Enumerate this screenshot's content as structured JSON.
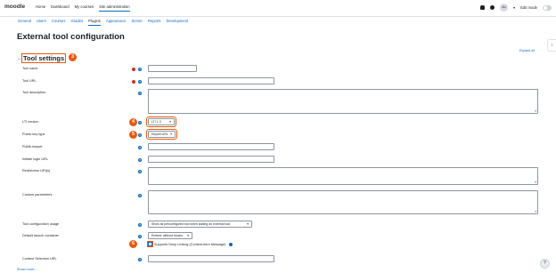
{
  "header": {
    "logo": "moodle",
    "nav": [
      "Home",
      "Dashboard",
      "My courses",
      "Site administration"
    ],
    "active_nav_index": 3,
    "avatar_initials": "AU",
    "edit_mode_label": "Edit mode"
  },
  "subnav": {
    "tabs": [
      "General",
      "Users",
      "Courses",
      "Grades",
      "Plugins",
      "Appearance",
      "Server",
      "Reports",
      "Development"
    ],
    "active_index": 4
  },
  "page": {
    "title": "External tool configuration",
    "expand_all": "Expand all"
  },
  "section": {
    "title": "Tool settings",
    "badge": "3"
  },
  "fields": {
    "tool_name": {
      "label": "Tool name",
      "value": ""
    },
    "tool_url": {
      "label": "Tool URL",
      "value": ""
    },
    "tool_description": {
      "label": "Tool description",
      "value": ""
    },
    "lti_version": {
      "label": "LTI version",
      "value": "LTI 1.3",
      "badge": "4"
    },
    "public_key_type": {
      "label": "Public key type",
      "value": "Keyset URL",
      "badge": "5"
    },
    "public_keyset": {
      "label": "Public keyset",
      "value": ""
    },
    "initiate_login_url": {
      "label": "Initiate login URL",
      "value": ""
    },
    "redirection_uris": {
      "label": "Redirection URI(s)",
      "value": ""
    },
    "custom_parameters": {
      "label": "Custom parameters",
      "value": ""
    },
    "tool_config_usage": {
      "label": "Tool configuration usage",
      "value": "Show as preconfigured tool when adding an external tool"
    },
    "default_launch_container": {
      "label": "Default launch container",
      "value": "Embed, without blocks"
    },
    "deep_linking": {
      "label": "Supports Deep Linking (Content-Item Message)",
      "checked": true,
      "badge": "6"
    },
    "content_selection_url": {
      "label": "Content Selection URL",
      "value": ""
    }
  },
  "show_more": "Show more...",
  "help_button": "?",
  "colors": {
    "accent": "#0f6cbf",
    "callout": "#e8590c",
    "required": "#ca3120"
  }
}
